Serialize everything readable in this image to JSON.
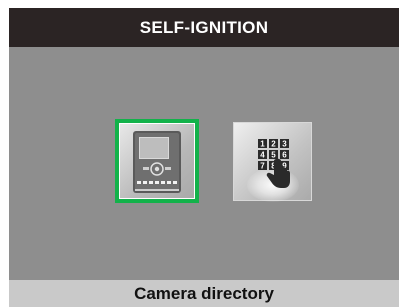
{
  "header": {
    "title": "SELF-IGNITION"
  },
  "icons": [
    {
      "name": "videophone-icon",
      "selected": true,
      "accent": "#12b24a"
    },
    {
      "name": "keypad-hand-icon",
      "selected": false,
      "digits": [
        "1",
        "2",
        "3",
        "4",
        "5",
        "6",
        "7",
        "8",
        "9"
      ]
    }
  ],
  "footer": {
    "label": "Camera directory"
  },
  "colors": {
    "title_bar": "#2b2424",
    "screen_bg": "#8e8e8e",
    "footer_bg": "#c9c9c9",
    "selection": "#12b24a"
  }
}
